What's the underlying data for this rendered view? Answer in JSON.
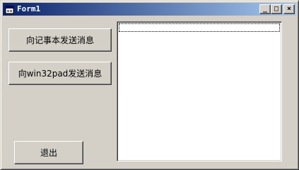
{
  "window": {
    "title": "Form1",
    "controls": {
      "minimize": "_",
      "maximize": "□",
      "close": "×"
    }
  },
  "buttons": {
    "send_notepad": "向记事本发送消息",
    "send_win32pad": "向win32pad发送消息",
    "exit": "退出"
  },
  "listbox": {
    "items": []
  }
}
